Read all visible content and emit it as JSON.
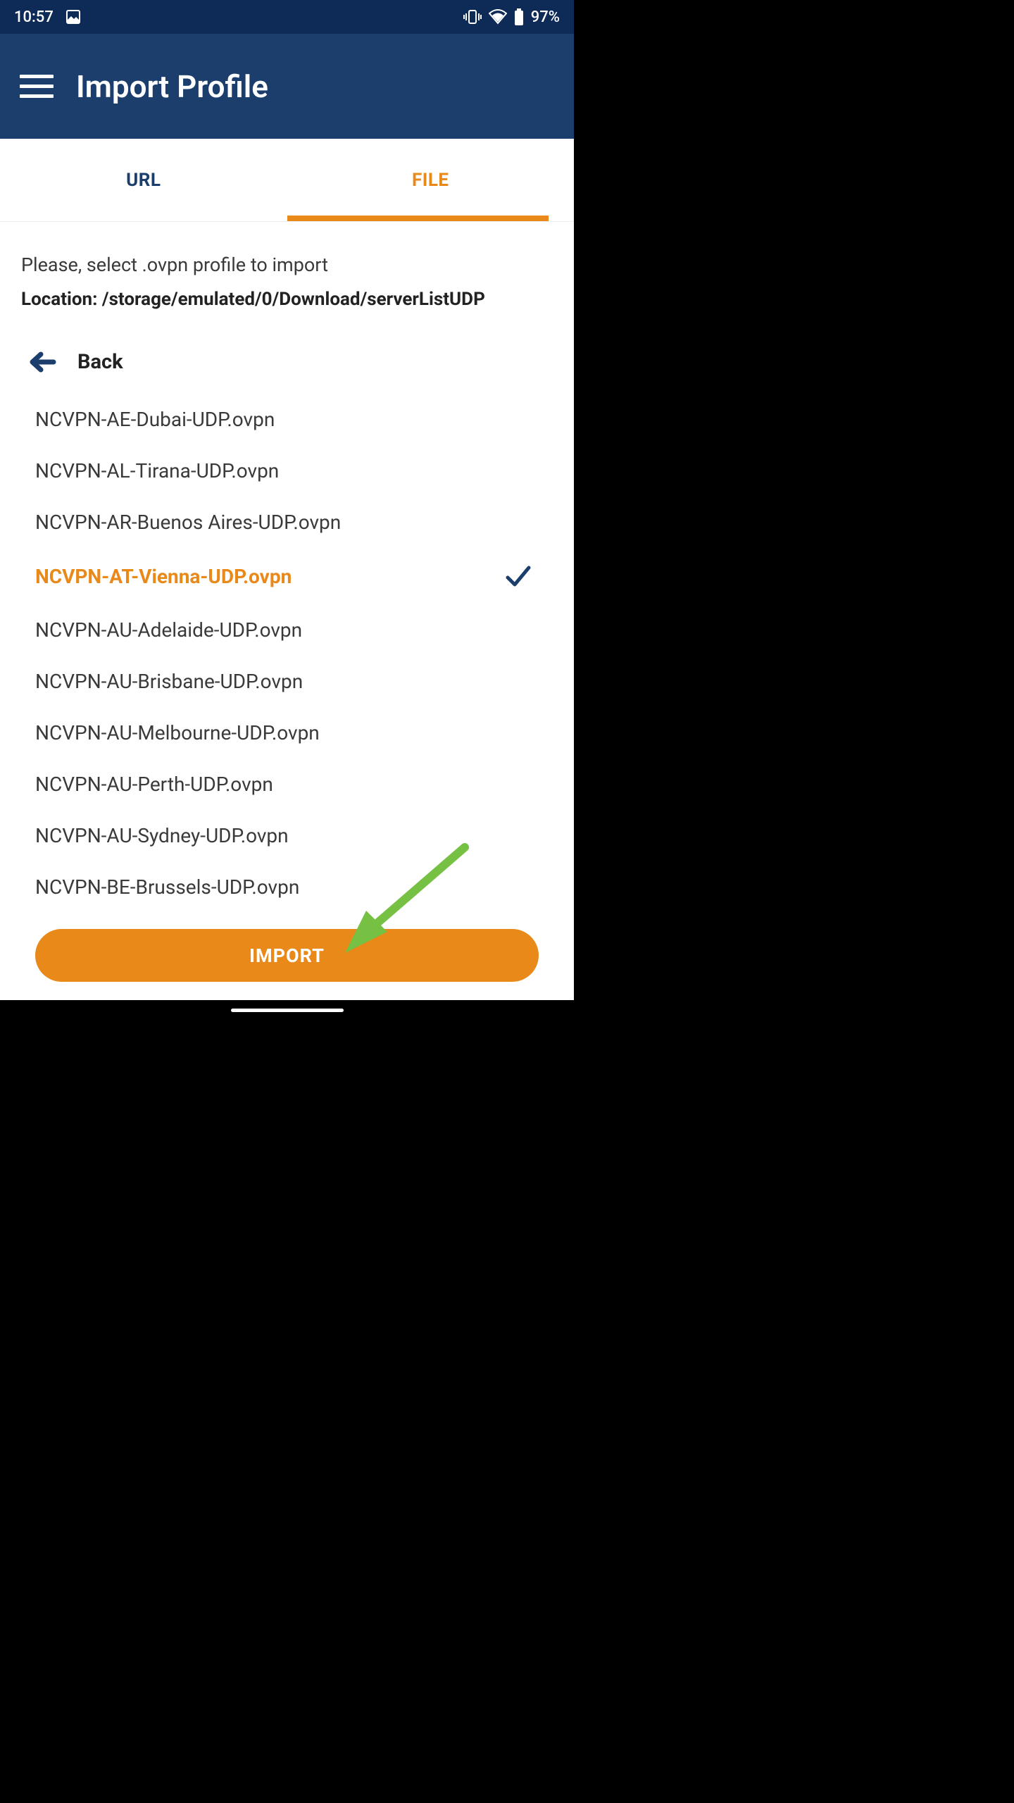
{
  "status": {
    "time": "10:57",
    "battery": "97%"
  },
  "header": {
    "title": "Import Profile"
  },
  "tabs": {
    "url": "URL",
    "file": "FILE",
    "activeIndex": 1
  },
  "instruction": "Please, select .ovpn profile to import",
  "location_label": "Location: /storage/emulated/0/Download/serverListUDP",
  "back_label": "Back",
  "files": [
    {
      "name": "NCVPN-AE-Dubai-UDP.ovpn",
      "selected": false
    },
    {
      "name": "NCVPN-AL-Tirana-UDP.ovpn",
      "selected": false
    },
    {
      "name": "NCVPN-AR-Buenos Aires-UDP.ovpn",
      "selected": false
    },
    {
      "name": "NCVPN-AT-Vienna-UDP.ovpn",
      "selected": true
    },
    {
      "name": "NCVPN-AU-Adelaide-UDP.ovpn",
      "selected": false
    },
    {
      "name": "NCVPN-AU-Brisbane-UDP.ovpn",
      "selected": false
    },
    {
      "name": "NCVPN-AU-Melbourne-UDP.ovpn",
      "selected": false
    },
    {
      "name": "NCVPN-AU-Perth-UDP.ovpn",
      "selected": false
    },
    {
      "name": "NCVPN-AU-Sydney-UDP.ovpn",
      "selected": false
    },
    {
      "name": "NCVPN-BE-Brussels-UDP.ovpn",
      "selected": false
    }
  ],
  "import_button": "IMPORT",
  "colors": {
    "accent": "#e8891a",
    "header": "#1b3e6d",
    "statusbar": "#0d2b56",
    "annotation": "#76c043"
  }
}
